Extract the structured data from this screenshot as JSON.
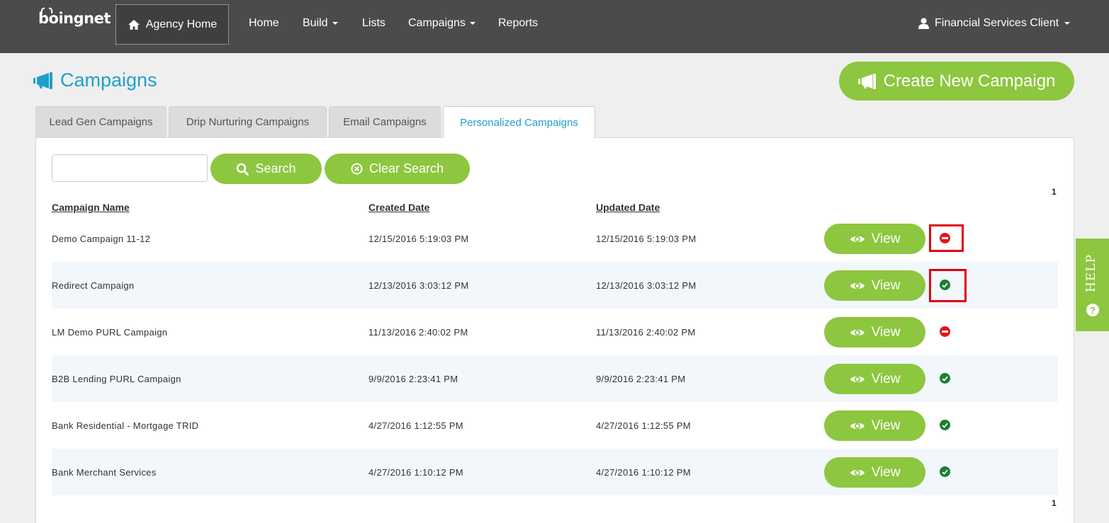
{
  "brand": {
    "logo_text": "boingnet",
    "accent": "#8dc63f",
    "link_blue": "#1ea1c9"
  },
  "nav": {
    "agency_home": "Agency Home",
    "items": [
      {
        "label": "Home",
        "dropdown": false
      },
      {
        "label": "Build",
        "dropdown": true
      },
      {
        "label": "Lists",
        "dropdown": false
      },
      {
        "label": "Campaigns",
        "dropdown": true
      },
      {
        "label": "Reports",
        "dropdown": false
      }
    ],
    "user": "Financial Services Client"
  },
  "page": {
    "title": "Campaigns",
    "create_button": "Create New Campaign"
  },
  "tabs": [
    {
      "label": "Lead Gen Campaigns",
      "active": false
    },
    {
      "label": "Drip Nurturing Campaigns",
      "active": false
    },
    {
      "label": "Email Campaigns",
      "active": false
    },
    {
      "label": "Personalized Campaigns",
      "active": true
    }
  ],
  "search": {
    "value": "",
    "placeholder": "",
    "search_label": "Search",
    "clear_label": "Clear Search"
  },
  "pagination": {
    "top": "1",
    "bottom": "1"
  },
  "table": {
    "columns": [
      "Campaign Name",
      "Created Date",
      "Updated Date"
    ],
    "view_label": "View",
    "rows": [
      {
        "name": "Demo Campaign 11-12",
        "created": "12/15/2016 5:19:03 PM",
        "updated": "12/15/2016 5:19:03 PM",
        "status": "inactive"
      },
      {
        "name": "Redirect Campaign",
        "created": "12/13/2016 3:03:12 PM",
        "updated": "12/13/2016 3:03:12 PM",
        "status": "active"
      },
      {
        "name": "LM Demo PURL Campaign",
        "created": "11/13/2016 2:40:02 PM",
        "updated": "11/13/2016 2:40:02 PM",
        "status": "inactive"
      },
      {
        "name": "B2B Lending PURL Campaign",
        "created": "9/9/2016 2:23:41 PM",
        "updated": "9/9/2016 2:23:41 PM",
        "status": "active"
      },
      {
        "name": "Bank Residential - Mortgage TRID",
        "created": "4/27/2016 1:12:55 PM",
        "updated": "4/27/2016 1:12:55 PM",
        "status": "active"
      },
      {
        "name": "Bank Merchant Services",
        "created": "4/27/2016 1:10:12 PM",
        "updated": "4/27/2016 1:10:12 PM",
        "status": "active"
      }
    ]
  },
  "help": {
    "label": "HELP"
  },
  "status_colors": {
    "active": "#1e7d32",
    "inactive": "#e0141e"
  }
}
